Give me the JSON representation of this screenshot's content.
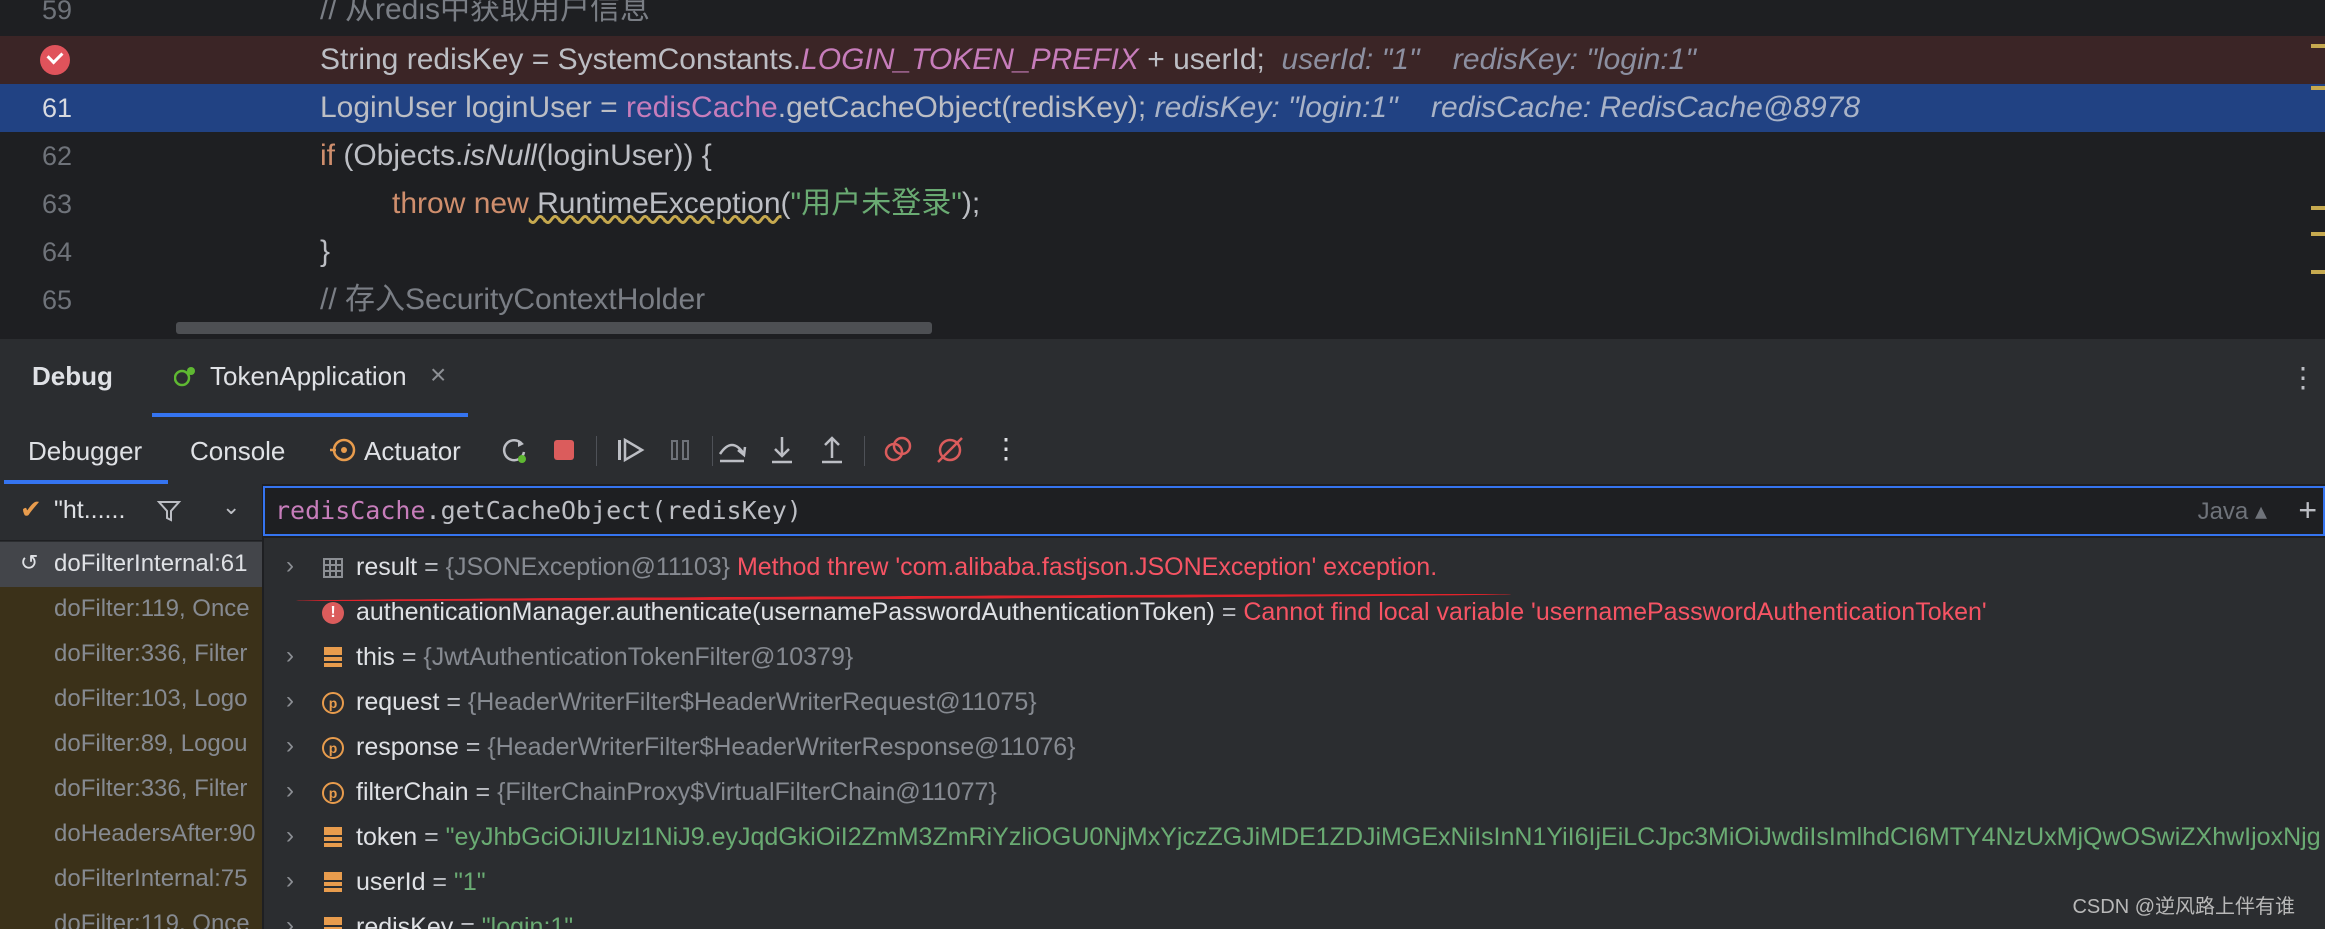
{
  "editor": {
    "lines": [
      {
        "num": "59",
        "code": "// 从redis中获取用户信息"
      },
      {
        "num": "",
        "code_parts": [
          "String redisKey = SystemConstants.",
          "LOGIN_TOKEN_PREFIX",
          " + userId;"
        ],
        "hint": "userId: \"1\"    redisKey: \"login:1\""
      },
      {
        "num": "61",
        "code_parts": [
          "LoginUser loginUser = ",
          "redisCache",
          ".getCacheObject(redisKey);"
        ],
        "hint": "redisKey: \"login:1\"    redisCache: RedisCache@8978"
      },
      {
        "num": "62",
        "code_parts": [
          "if",
          " (Objects.",
          "isNull",
          "(loginUser)) {"
        ]
      },
      {
        "num": "63",
        "code_parts": [
          "throw",
          " ",
          "new",
          " RuntimeException(",
          "\"用户未登录\"",
          ");"
        ]
      },
      {
        "num": "64",
        "code": "}"
      },
      {
        "num": "65",
        "code": "// 存入SecurityContextHolder"
      }
    ]
  },
  "debug": {
    "title": "Debug",
    "session_tab": "TokenApplication",
    "tabs": {
      "debugger": "Debugger",
      "console": "Console",
      "actuator": "Actuator"
    }
  },
  "frames": {
    "thread": "\"ht......",
    "items": [
      "doFilterInternal:61",
      "doFilter:119, Once",
      "doFilter:336, Filter",
      "doFilter:103, Logo",
      "doFilter:89, Logou",
      "doFilter:336, Filter",
      "doHeadersAfter:90",
      "doFilterInternal:75",
      "doFilter:119, Once"
    ]
  },
  "evaluate": {
    "expression_parts": [
      "redisCache",
      ".getCacheObject(redisKey)"
    ],
    "language": "Java"
  },
  "variables": [
    {
      "icon": "array-icon",
      "name": "result",
      "value": "{JSONException@11103}",
      "error": "Method threw 'com.alibaba.fastjson.JSONException' exception."
    },
    {
      "icon": "error-icon",
      "name": "authenticationManager.authenticate(usernamePasswordAuthenticationToken)",
      "error": "Cannot find local variable 'usernamePasswordAuthenticationToken'"
    },
    {
      "icon": "field-icon",
      "name": "this",
      "value": "{JwtAuthenticationTokenFilter@10379}"
    },
    {
      "icon": "param-icon",
      "name": "request",
      "value": "{HeaderWriterFilter$HeaderWriterRequest@11075}"
    },
    {
      "icon": "param-icon",
      "name": "response",
      "value": "{HeaderWriterFilter$HeaderWriterResponse@11076}"
    },
    {
      "icon": "param-icon",
      "name": "filterChain",
      "value": "{FilterChainProxy$VirtualFilterChain@11077}"
    },
    {
      "icon": "field-icon",
      "name": "token",
      "str": "\"eyJhbGciOiJIUzI1NiJ9.eyJqdGkiOiI2ZmM3ZmRiYzliOGU0NjMxYjczZGJiMDE1ZDJiMGExNiIsInN1YiI6IjEiLCJpc3MiOiJwdiIsImlhdCI6MTY4NzUxMjQwOSwiZXhwIjoxNjg"
    },
    {
      "icon": "field-icon",
      "name": "userId",
      "str": "\"1\""
    },
    {
      "icon": "field-icon",
      "name": "redisKey",
      "str": "\"login:1\""
    }
  ],
  "watermark": "CSDN @逆风路上伴有谁",
  "colors": {
    "accent": "#3574f0",
    "error": "#f75464",
    "string": "#6aab73",
    "breakpoint": "#e0535b"
  }
}
